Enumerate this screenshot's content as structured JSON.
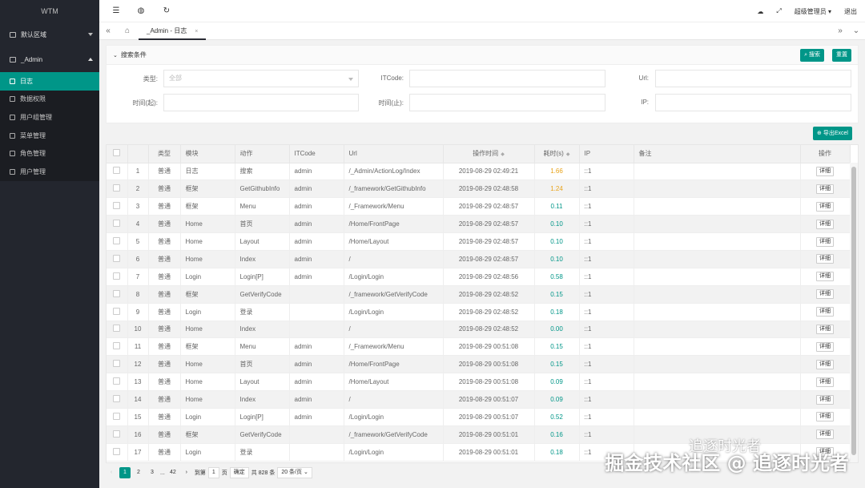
{
  "app": {
    "title": "WTM"
  },
  "sidebar": {
    "groups": [
      {
        "label": "默认区域"
      },
      {
        "label": "_Admin"
      }
    ],
    "items": [
      {
        "label": "日志"
      },
      {
        "label": "数据权限"
      },
      {
        "label": "用户组管理"
      },
      {
        "label": "菜单管理"
      },
      {
        "label": "角色管理"
      },
      {
        "label": "用户管理"
      }
    ]
  },
  "topbar": {
    "user": "超级管理员",
    "logout": "退出"
  },
  "tabs": {
    "active": "_Admin - 日志",
    "close": "×"
  },
  "search": {
    "title": "搜索条件",
    "search_btn": "搜索",
    "reset_btn": "重置",
    "type_label": "类型:",
    "type_placeholder": "全部",
    "itcode_label": "ITCode:",
    "url_label": "Url:",
    "start_label": "时间(起):",
    "end_label": "时间(止):",
    "ip_label": "IP:"
  },
  "export_btn": "导出Excel",
  "table": {
    "columns": [
      "类型",
      "模块",
      "动作",
      "ITCode",
      "Url",
      "操作时间",
      "耗时(s)",
      "IP",
      "备注",
      "操作"
    ],
    "detail": "详细",
    "rows": [
      [
        "1",
        "普通",
        "日志",
        "搜索",
        "admin",
        "/_Admin/ActionLog/Index",
        "2019-08-29 02:49:21",
        "1.66",
        "::1"
      ],
      [
        "2",
        "普通",
        "框架",
        "GetGithubInfo",
        "admin",
        "/_framework/GetGithubInfo",
        "2019-08-29 02:48:58",
        "1.24",
        "::1"
      ],
      [
        "3",
        "普通",
        "框架",
        "Menu",
        "admin",
        "/_Framework/Menu",
        "2019-08-29 02:48:57",
        "0.11",
        "::1"
      ],
      [
        "4",
        "普通",
        "Home",
        "首页",
        "admin",
        "/Home/FrontPage",
        "2019-08-29 02:48:57",
        "0.10",
        "::1"
      ],
      [
        "5",
        "普通",
        "Home",
        "Layout",
        "admin",
        "/Home/Layout",
        "2019-08-29 02:48:57",
        "0.10",
        "::1"
      ],
      [
        "6",
        "普通",
        "Home",
        "Index",
        "admin",
        "/",
        "2019-08-29 02:48:57",
        "0.10",
        "::1"
      ],
      [
        "7",
        "普通",
        "Login",
        "Login[P]",
        "admin",
        "/Login/Login",
        "2019-08-29 02:48:56",
        "0.58",
        "::1"
      ],
      [
        "8",
        "普通",
        "框架",
        "GetVerifyCode",
        "",
        "/_framework/GetVerifyCode",
        "2019-08-29 02:48:52",
        "0.15",
        "::1"
      ],
      [
        "9",
        "普通",
        "Login",
        "登录",
        "",
        "/Login/Login",
        "2019-08-29 02:48:52",
        "0.18",
        "::1"
      ],
      [
        "10",
        "普通",
        "Home",
        "Index",
        "",
        "/",
        "2019-08-29 02:48:52",
        "0.00",
        "::1"
      ],
      [
        "11",
        "普通",
        "框架",
        "Menu",
        "admin",
        "/_Framework/Menu",
        "2019-08-29 00:51:08",
        "0.15",
        "::1"
      ],
      [
        "12",
        "普通",
        "Home",
        "首页",
        "admin",
        "/Home/FrontPage",
        "2019-08-29 00:51:08",
        "0.15",
        "::1"
      ],
      [
        "13",
        "普通",
        "Home",
        "Layout",
        "admin",
        "/Home/Layout",
        "2019-08-29 00:51:08",
        "0.09",
        "::1"
      ],
      [
        "14",
        "普通",
        "Home",
        "Index",
        "admin",
        "/",
        "2019-08-29 00:51:07",
        "0.09",
        "::1"
      ],
      [
        "15",
        "普通",
        "Login",
        "Login[P]",
        "admin",
        "/Login/Login",
        "2019-08-29 00:51:07",
        "0.52",
        "::1"
      ],
      [
        "16",
        "普通",
        "框架",
        "GetVerifyCode",
        "",
        "/_framework/GetVerifyCode",
        "2019-08-29 00:51:01",
        "0.16",
        "::1"
      ],
      [
        "17",
        "普通",
        "Login",
        "登录",
        "",
        "/Login/Login",
        "2019-08-29 00:51:01",
        "0.18",
        "::1"
      ]
    ]
  },
  "pager": {
    "prev": "‹",
    "p1": "1",
    "p2": "2",
    "p3": "3",
    "ellipsis": "...",
    "last": "42",
    "next": "›",
    "goto": "到第",
    "goto_val": "1",
    "page_unit": "页",
    "confirm": "确定",
    "total": "共 828 条",
    "size": "20 条/页"
  },
  "watermark": {
    "main": "掘金技术社区 @ 追逐时光者",
    "sub": "追逐时光者"
  }
}
